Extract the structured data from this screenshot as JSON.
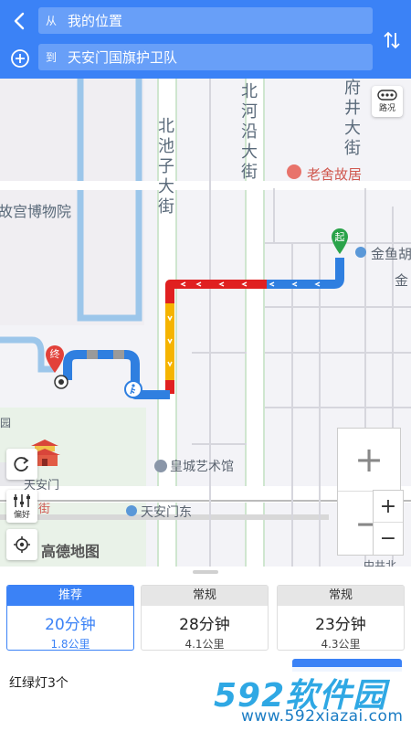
{
  "search": {
    "from_prefix": "从",
    "from_value": "我的位置",
    "to_prefix": "到",
    "to_value": "天安门国旗护卫队"
  },
  "map": {
    "streets": {
      "beichizi": "北池子大街",
      "beiheyan": "北河沿大街",
      "fujing": "府井大街"
    },
    "places": {
      "palace_museum": "故宫博物院",
      "laoshe": "老舍故居",
      "jinyu": "金鱼胡",
      "jin": "金",
      "huangcheng": "皇城艺术馆",
      "tiananmen": "天安门",
      "tiananmen_east": "天安门东",
      "jie": "街",
      "yuan": "园",
      "zhongjing": "中井北"
    },
    "markers": {
      "start": "起",
      "end": "终"
    },
    "traffic_button": "路况",
    "prefer_button": "偏好",
    "zoom_in": "+",
    "zoom_out": "−",
    "logo": "高德地图"
  },
  "routes": [
    {
      "tag": "推荐",
      "duration": "20分钟",
      "distance": "1.8公里",
      "selected": true
    },
    {
      "tag": "常规",
      "duration": "28分钟",
      "distance": "4.1公里",
      "selected": false
    },
    {
      "tag": "常规",
      "duration": "23分钟",
      "distance": "4.3公里",
      "selected": false
    }
  ],
  "traffic_lights": "红绿灯3个",
  "watermark": {
    "brand_num": "592",
    "brand_cn": "软件园",
    "url": "www.592xiazai.com"
  },
  "colors": {
    "accent": "#3b82f6",
    "jam": "#e02020",
    "slow": "#f5b400",
    "smooth": "#2f7fe0",
    "park": "#cfe6cf"
  }
}
